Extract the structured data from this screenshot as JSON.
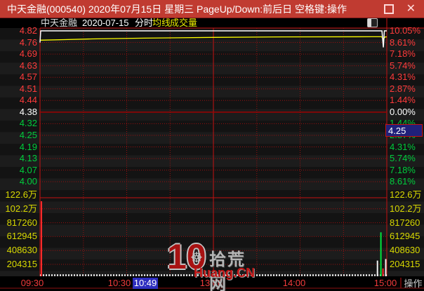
{
  "window": {
    "title": "中天金融(000540) 2020年07月15日 星期三 PageUp/Down:前后日 空格键:操作",
    "close_glyph": "✕"
  },
  "legend": {
    "stock": "中天金融",
    "date": "2020-07-15",
    "mode": "分时",
    "ma": "均线",
    "vol": "成交量"
  },
  "tags": {
    "price": "4.25",
    "time": "10:49"
  },
  "footer": {
    "action": "操作"
  },
  "watermark": {
    "big": "10",
    "gear": "☸",
    "site": "拾荒网",
    "domain": "Huang.CN"
  },
  "colors": {
    "titlebar": "#c03b31",
    "up": "#ff3b3b",
    "down": "#00cd3c",
    "flat": "#ffffff",
    "volume_label": "#d8d800",
    "grid": "#9b0f0f",
    "grid_solid": "#c41212",
    "prev_close_line": "#a80000",
    "price_line": "#ffffff",
    "avg_line": "#ffff00",
    "bar_red": "#ff2a2a",
    "bar_green": "#00e63c",
    "bar_white": "#f2f2f2",
    "highlight_blue": "#2e2ec0",
    "tag_navy": "#20207a",
    "time_red": "#f23b3b"
  },
  "chart_data": {
    "type": "line",
    "title": "中天金融 2020-07-15 分时",
    "prev_close": 4.38,
    "last_price": 4.82,
    "change_pct": "+10.05%",
    "price_axis_labels": [
      "4.82",
      "4.76",
      "4.69",
      "4.63",
      "4.57",
      "4.51",
      "4.44",
      "4.38",
      "4.32",
      "4.25",
      "4.19",
      "4.13",
      "4.07",
      "4.00"
    ],
    "pct_axis_labels": [
      "10.05%",
      "8.61%",
      "7.18%",
      "5.74%",
      "4.31%",
      "2.87%",
      "1.44%",
      "0.00%",
      "1.44%",
      "2.87%",
      "4.31%",
      "5.74%",
      "7.18%",
      "8.61%"
    ],
    "flat_index": 7,
    "volume_axis_labels": [
      "122.6万",
      "102.2万",
      "817260",
      "612945",
      "408630",
      "204315"
    ],
    "time_labels": [
      "09:30",
      "10:30",
      "13:00",
      "14:00",
      "15:00"
    ],
    "time_grid": [
      {
        "t": 0.125,
        "solid": false
      },
      {
        "t": 0.25,
        "solid": false
      },
      {
        "t": 0.375,
        "solid": false
      },
      {
        "t": 0.5,
        "solid": true
      },
      {
        "t": 0.625,
        "solid": false
      },
      {
        "t": 0.75,
        "solid": false
      },
      {
        "t": 0.875,
        "solid": false
      }
    ],
    "price_series_pct": [
      [
        0,
        8.6
      ],
      [
        0.002,
        10.05
      ],
      [
        0.986,
        10.05
      ],
      [
        0.99,
        8.0
      ],
      [
        0.993,
        10.05
      ],
      [
        1,
        10.05
      ]
    ],
    "avg_series_pct": [
      [
        0,
        8.9
      ],
      [
        0.07,
        8.97
      ],
      [
        0.15,
        9.05
      ],
      [
        0.3,
        9.15
      ],
      [
        0.5,
        9.24
      ],
      [
        0.7,
        9.3
      ],
      [
        0.96,
        9.32
      ],
      [
        0.985,
        9.32
      ],
      [
        0.99,
        9.0
      ],
      [
        0.995,
        9.3
      ],
      [
        1,
        9.3
      ]
    ],
    "volume_bars": [
      {
        "t": 0.004,
        "frac": 0.955,
        "color": "red"
      },
      {
        "t": 0.973,
        "frac": 0.2,
        "color": "white"
      },
      {
        "t": 0.983,
        "frac": 0.56,
        "color": "green"
      },
      {
        "t": 0.989,
        "frac": 0.1,
        "color": "red"
      },
      {
        "t": 0.997,
        "frac": 0.22,
        "color": "white"
      }
    ]
  }
}
